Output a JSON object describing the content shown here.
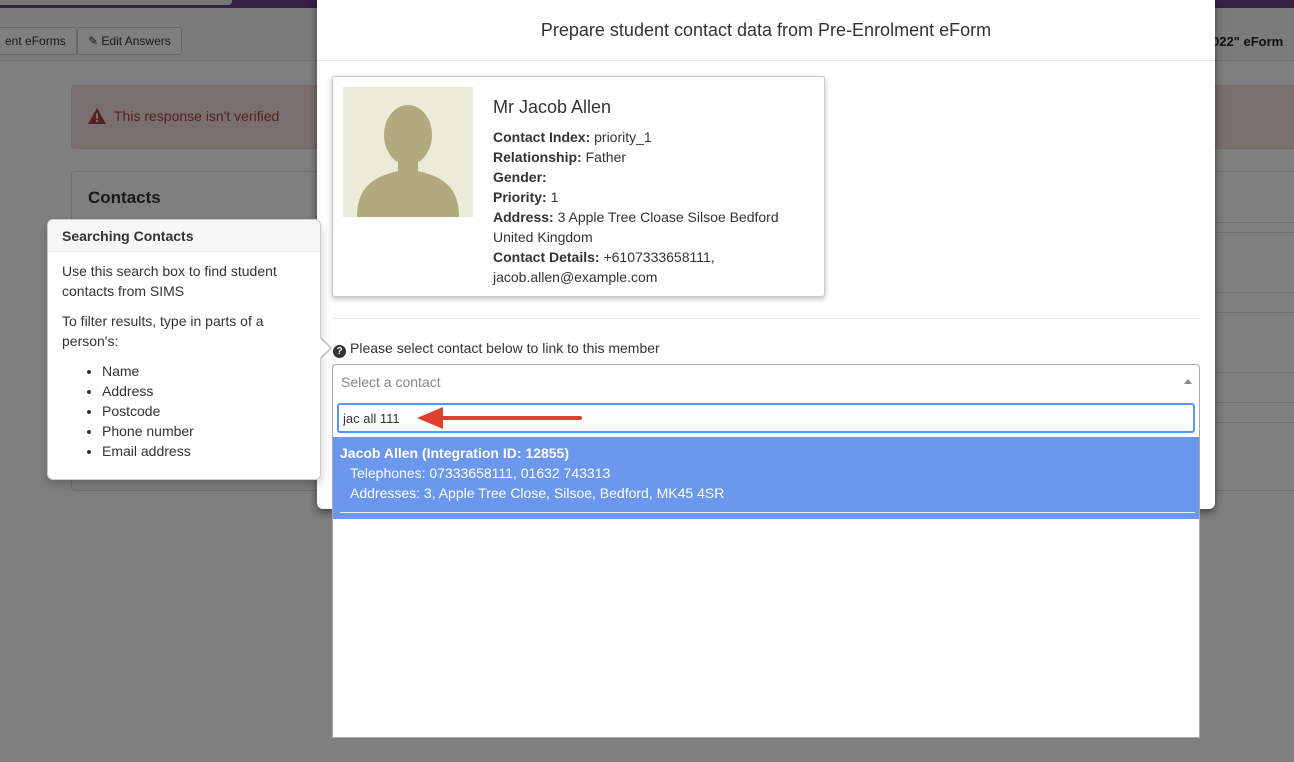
{
  "background": {
    "toolbar": {
      "forms_button": "ent eForms",
      "edit_button": "Edit Answers",
      "title_fragment": "022\" eForm"
    },
    "alert_text": "This response isn't verified",
    "panel_title": "Contacts"
  },
  "modal": {
    "title": "Prepare student contact data from Pre-Enrolment eForm",
    "contact": {
      "name": "Mr Jacob Allen",
      "fields": [
        {
          "label": "Contact Index:",
          "value": "priority_1"
        },
        {
          "label": "Relationship:",
          "value": "Father"
        },
        {
          "label": "Gender:",
          "value": ""
        },
        {
          "label": "Priority:",
          "value": "1"
        },
        {
          "label": "Address:",
          "value": "3 Apple Tree Cloase Silsoe Bedford United Kingdom"
        },
        {
          "label": "Contact Details:",
          "value": "+6107333658111, jacob.allen@example.com"
        }
      ]
    },
    "select_help": "Please select contact below to link to this member",
    "select_placeholder": "Select a contact",
    "search_value": "jac all 111",
    "result": {
      "title": "Jacob Allen (Integration ID: 12855)",
      "telephones": "Telephones: 07333658111, 01632 743313",
      "addresses": "Addresses: 3, Apple Tree Close, Silsoe, Bedford, MK45 4SR"
    }
  },
  "popover": {
    "title": "Searching Contacts",
    "intro": "Use this search box to find student contacts from SIMS",
    "filter_text": "To filter results, type in parts of a person's:",
    "items": [
      "Name",
      "Address",
      "Postcode",
      "Phone number",
      "Email address"
    ]
  },
  "colors": {
    "brand_purple": "#6b3f86",
    "highlight_blue": "#6b98ee",
    "focus_blue": "#5897fb",
    "annotation_red": "#e0402f"
  }
}
